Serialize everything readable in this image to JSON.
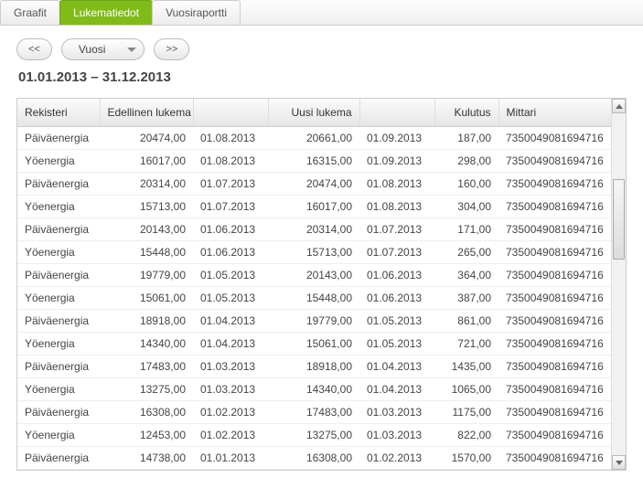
{
  "tabs": {
    "graafit": "Graafit",
    "lukematiedot": "Lukematiedot",
    "vuosiraportti": "Vuosiraportti"
  },
  "toolbar": {
    "prev": "<<",
    "next": ">>",
    "select": "Vuosi"
  },
  "range": "01.01.2013 –  31.12.2013",
  "headers": {
    "rekisteri": "Rekisteri",
    "edellinen": "Edellinen lukema",
    "ed_date": "",
    "uusi": "Uusi lukema",
    "uusi_date": "",
    "kulutus": "Kulutus",
    "mittari": "Mittari"
  },
  "rows": [
    {
      "r": "Päiväenergia",
      "pv": "20474,00",
      "pd": "01.08.2013",
      "nv": "20661,00",
      "nd": "01.09.2013",
      "c": "187,00",
      "m": "7350049081694716"
    },
    {
      "r": "Yöenergia",
      "pv": "16017,00",
      "pd": "01.08.2013",
      "nv": "16315,00",
      "nd": "01.09.2013",
      "c": "298,00",
      "m": "7350049081694716"
    },
    {
      "r": "Päiväenergia",
      "pv": "20314,00",
      "pd": "01.07.2013",
      "nv": "20474,00",
      "nd": "01.08.2013",
      "c": "160,00",
      "m": "7350049081694716"
    },
    {
      "r": "Yöenergia",
      "pv": "15713,00",
      "pd": "01.07.2013",
      "nv": "16017,00",
      "nd": "01.08.2013",
      "c": "304,00",
      "m": "7350049081694716"
    },
    {
      "r": "Päiväenergia",
      "pv": "20143,00",
      "pd": "01.06.2013",
      "nv": "20314,00",
      "nd": "01.07.2013",
      "c": "171,00",
      "m": "7350049081694716"
    },
    {
      "r": "Yöenergia",
      "pv": "15448,00",
      "pd": "01.06.2013",
      "nv": "15713,00",
      "nd": "01.07.2013",
      "c": "265,00",
      "m": "7350049081694716"
    },
    {
      "r": "Päiväenergia",
      "pv": "19779,00",
      "pd": "01.05.2013",
      "nv": "20143,00",
      "nd": "01.06.2013",
      "c": "364,00",
      "m": "7350049081694716"
    },
    {
      "r": "Yöenergia",
      "pv": "15061,00",
      "pd": "01.05.2013",
      "nv": "15448,00",
      "nd": "01.06.2013",
      "c": "387,00",
      "m": "7350049081694716"
    },
    {
      "r": "Päiväenergia",
      "pv": "18918,00",
      "pd": "01.04.2013",
      "nv": "19779,00",
      "nd": "01.05.2013",
      "c": "861,00",
      "m": "7350049081694716"
    },
    {
      "r": "Yöenergia",
      "pv": "14340,00",
      "pd": "01.04.2013",
      "nv": "15061,00",
      "nd": "01.05.2013",
      "c": "721,00",
      "m": "7350049081694716"
    },
    {
      "r": "Päiväenergia",
      "pv": "17483,00",
      "pd": "01.03.2013",
      "nv": "18918,00",
      "nd": "01.04.2013",
      "c": "1435,00",
      "m": "7350049081694716"
    },
    {
      "r": "Yöenergia",
      "pv": "13275,00",
      "pd": "01.03.2013",
      "nv": "14340,00",
      "nd": "01.04.2013",
      "c": "1065,00",
      "m": "7350049081694716"
    },
    {
      "r": "Päiväenergia",
      "pv": "16308,00",
      "pd": "01.02.2013",
      "nv": "17483,00",
      "nd": "01.03.2013",
      "c": "1175,00",
      "m": "7350049081694716"
    },
    {
      "r": "Yöenergia",
      "pv": "12453,00",
      "pd": "01.02.2013",
      "nv": "13275,00",
      "nd": "01.03.2013",
      "c": "822,00",
      "m": "7350049081694716"
    },
    {
      "r": "Päiväenergia",
      "pv": "14738,00",
      "pd": "01.01.2013",
      "nv": "16308,00",
      "nd": "01.02.2013",
      "c": "1570,00",
      "m": "7350049081694716"
    }
  ]
}
